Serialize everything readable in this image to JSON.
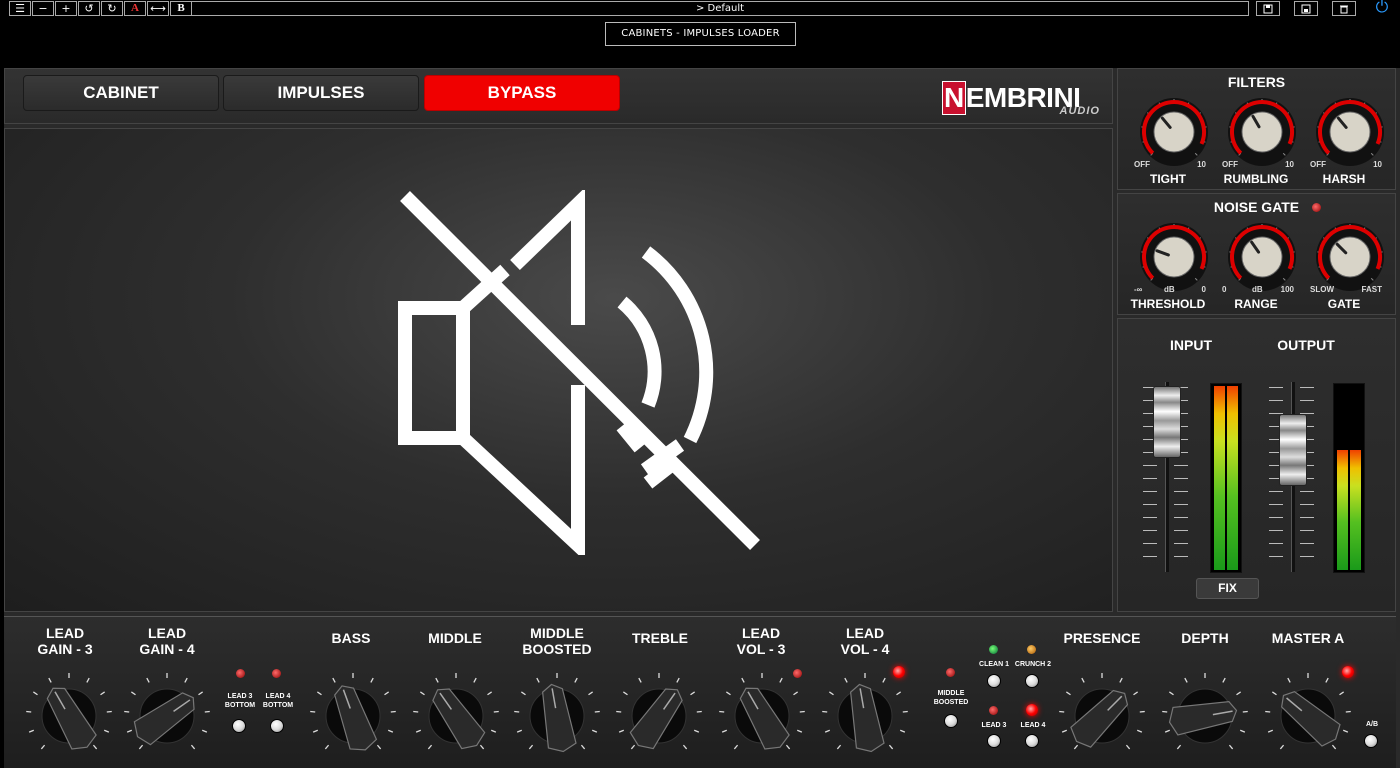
{
  "host": {
    "menu_icon": "menu-icon",
    "minus_icon": "minus-icon",
    "plus_icon": "plus-icon",
    "undo_icon": "undo-icon",
    "redo_icon": "redo-icon",
    "a_label": "A",
    "swap_icon": "swap-icon",
    "b_label": "B",
    "preset": "> Default",
    "save_icon": "save-icon",
    "save_as_icon": "save-as-icon",
    "delete_icon": "trash-icon",
    "power_icon": "power-icon"
  },
  "plugin_title": "CABINETS - IMPULSES LOADER",
  "tabs": [
    {
      "label": "CABINET",
      "active": false
    },
    {
      "label": "IMPULSES",
      "active": false
    },
    {
      "label": "BYPASS",
      "active": true
    }
  ],
  "logo": {
    "main": "EMBRINI",
    "initial": "N",
    "sub": "AUDIO"
  },
  "main_icon": "speaker-muted-icon",
  "filters": {
    "title": "FILTERS",
    "knobs": [
      {
        "label": "TIGHT",
        "min": "OFF",
        "max": "10"
      },
      {
        "label": "RUMBLING",
        "min": "OFF",
        "max": "10"
      },
      {
        "label": "HARSH",
        "min": "OFF",
        "max": "10"
      }
    ]
  },
  "noise_gate": {
    "title": "NOISE GATE",
    "knobs": [
      {
        "label": "THRESHOLD",
        "min": "-∞",
        "mid": "dB",
        "max": "0"
      },
      {
        "label": "RANGE",
        "min": "0",
        "mid": "dB",
        "max": "100"
      },
      {
        "label": "GATE",
        "min": "SLOW",
        "max": "FAST"
      }
    ]
  },
  "io": {
    "input_label": "INPUT",
    "output_label": "OUTPUT",
    "fix_label": "FIX",
    "input_meter_level": 1.0,
    "output_meter_level": 0.65
  },
  "amp": {
    "knobs": [
      {
        "label": "LEAD\nGAIN - 3"
      },
      {
        "label": "LEAD\nGAIN - 4"
      },
      {
        "label": "BASS"
      },
      {
        "label": "MIDDLE"
      },
      {
        "label": "MIDDLE\nBOOSTED"
      },
      {
        "label": "TREBLE"
      },
      {
        "label": "LEAD\nVOL - 3"
      },
      {
        "label": "LEAD\nVOL - 4"
      },
      {
        "label": "PRESENCE"
      },
      {
        "label": "DEPTH"
      },
      {
        "label": "MASTER A"
      }
    ],
    "switches": {
      "lead3_bottom": "LEAD 3\nBOTTOM",
      "lead4_bottom": "LEAD 4\nBOTTOM",
      "middle_boosted": "MIDDLE\nBOOSTED",
      "clean1": "CLEAN 1",
      "crunch2": "CRUNCH 2",
      "lead3": "LEAD 3",
      "lead4": "LEAD 4",
      "ab": "A/B"
    }
  }
}
